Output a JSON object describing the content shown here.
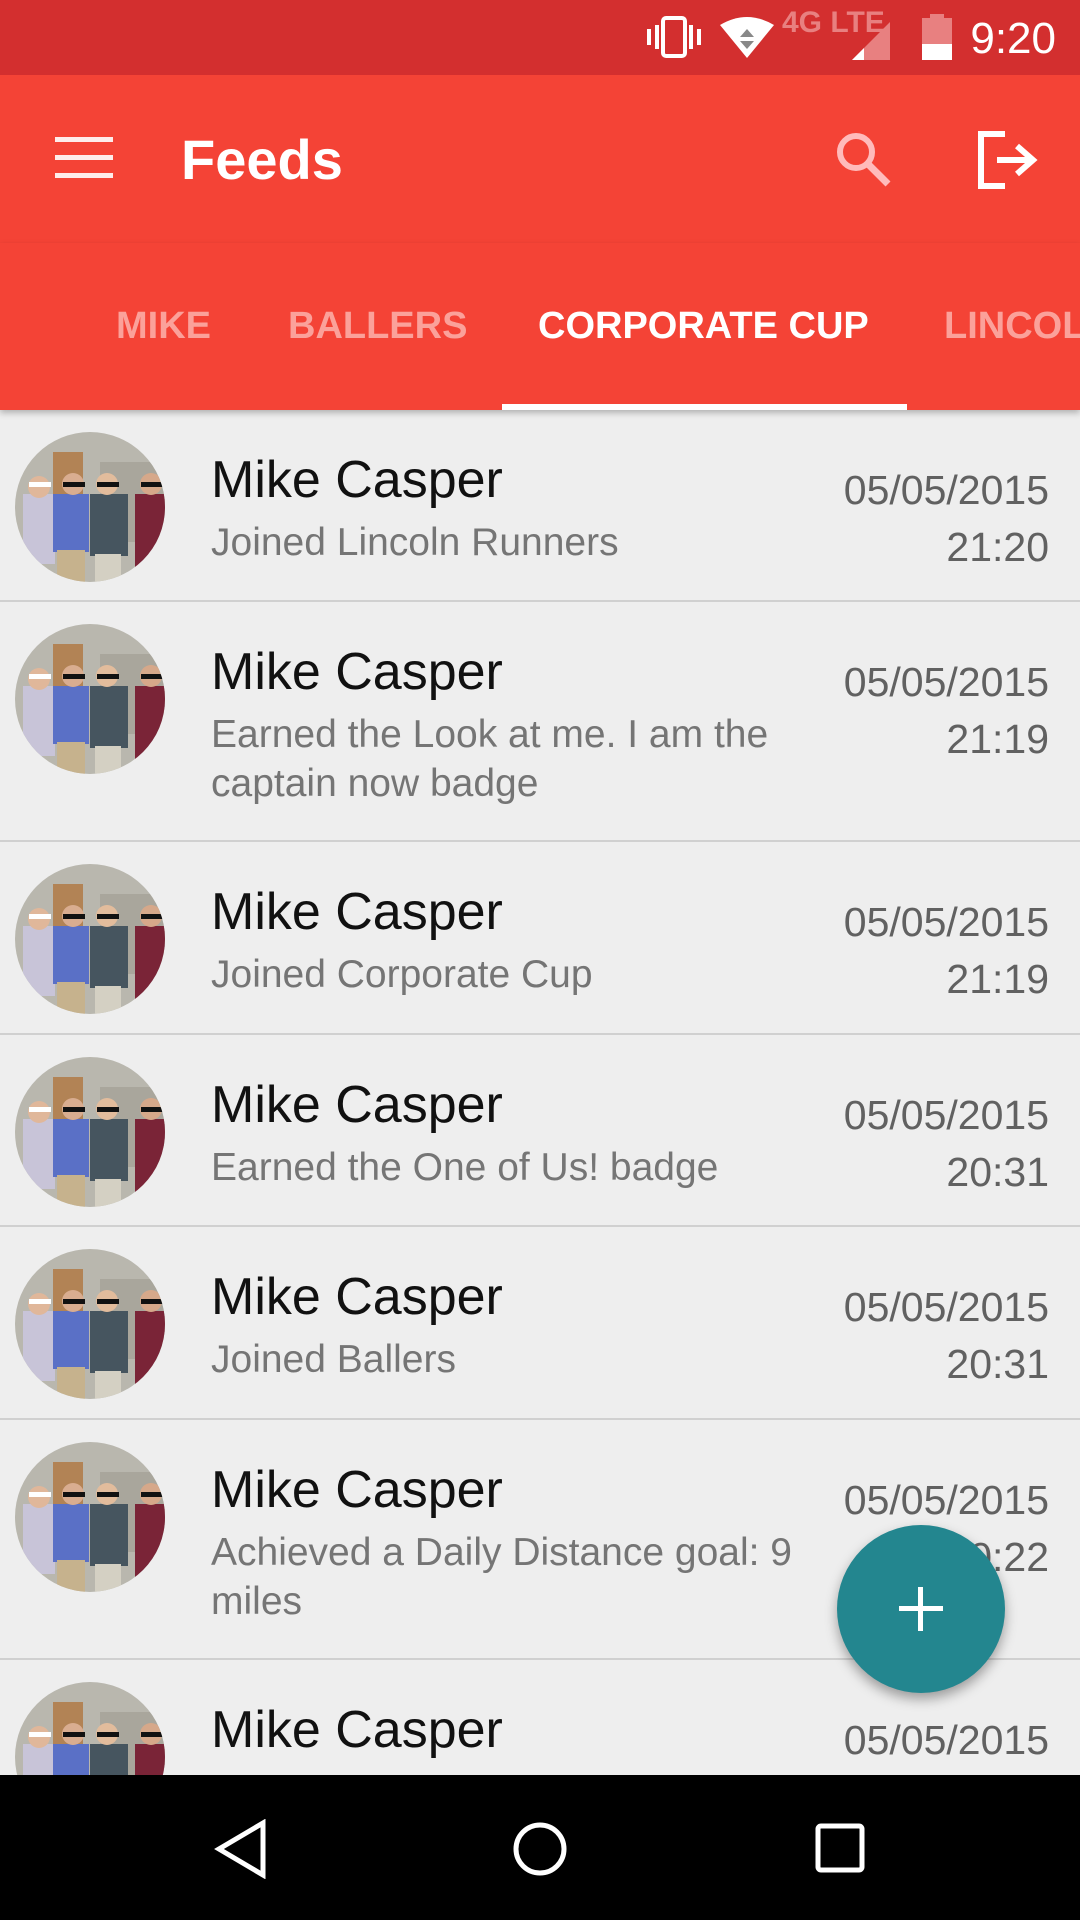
{
  "status_bar": {
    "time": "9:20",
    "network": "4G LTE",
    "icons": [
      "vibrate-icon",
      "wifi-icon",
      "signal-icon",
      "battery-icon"
    ]
  },
  "toolbar": {
    "title": "Feeds",
    "icons": [
      "menu-icon",
      "search-icon",
      "logout-icon"
    ]
  },
  "tabs": [
    {
      "label": "MIKE"
    },
    {
      "label": "BALLERS"
    },
    {
      "label": "CORPORATE CUP",
      "active": true
    },
    {
      "label": "LINCOLN"
    }
  ],
  "feed": [
    {
      "name": "Mike Casper",
      "text": "Joined Lincoln Runners",
      "date": "05/05/2015",
      "time": "21:20"
    },
    {
      "name": "Mike Casper",
      "text": "Earned the Look at me. I am the captain now badge",
      "date": "05/05/2015",
      "time": "21:19"
    },
    {
      "name": "Mike Casper",
      "text": "Joined Corporate Cup",
      "date": "05/05/2015",
      "time": "21:19"
    },
    {
      "name": "Mike Casper",
      "text": "Earned the One of Us! badge",
      "date": "05/05/2015",
      "time": "20:31"
    },
    {
      "name": "Mike Casper",
      "text": "Joined Ballers",
      "date": "05/05/2015",
      "time": "20:31"
    },
    {
      "name": "Mike Casper",
      "text": "Achieved a Daily Distance goal: 9 miles",
      "date": "05/05/2015",
      "time": "20:22"
    },
    {
      "name": "Mike Casper",
      "text": "",
      "date": "05/05/2015",
      "time": ""
    }
  ],
  "colors": {
    "status": "#d32f2f",
    "primary": "#f44336",
    "fab": "#23868f"
  }
}
